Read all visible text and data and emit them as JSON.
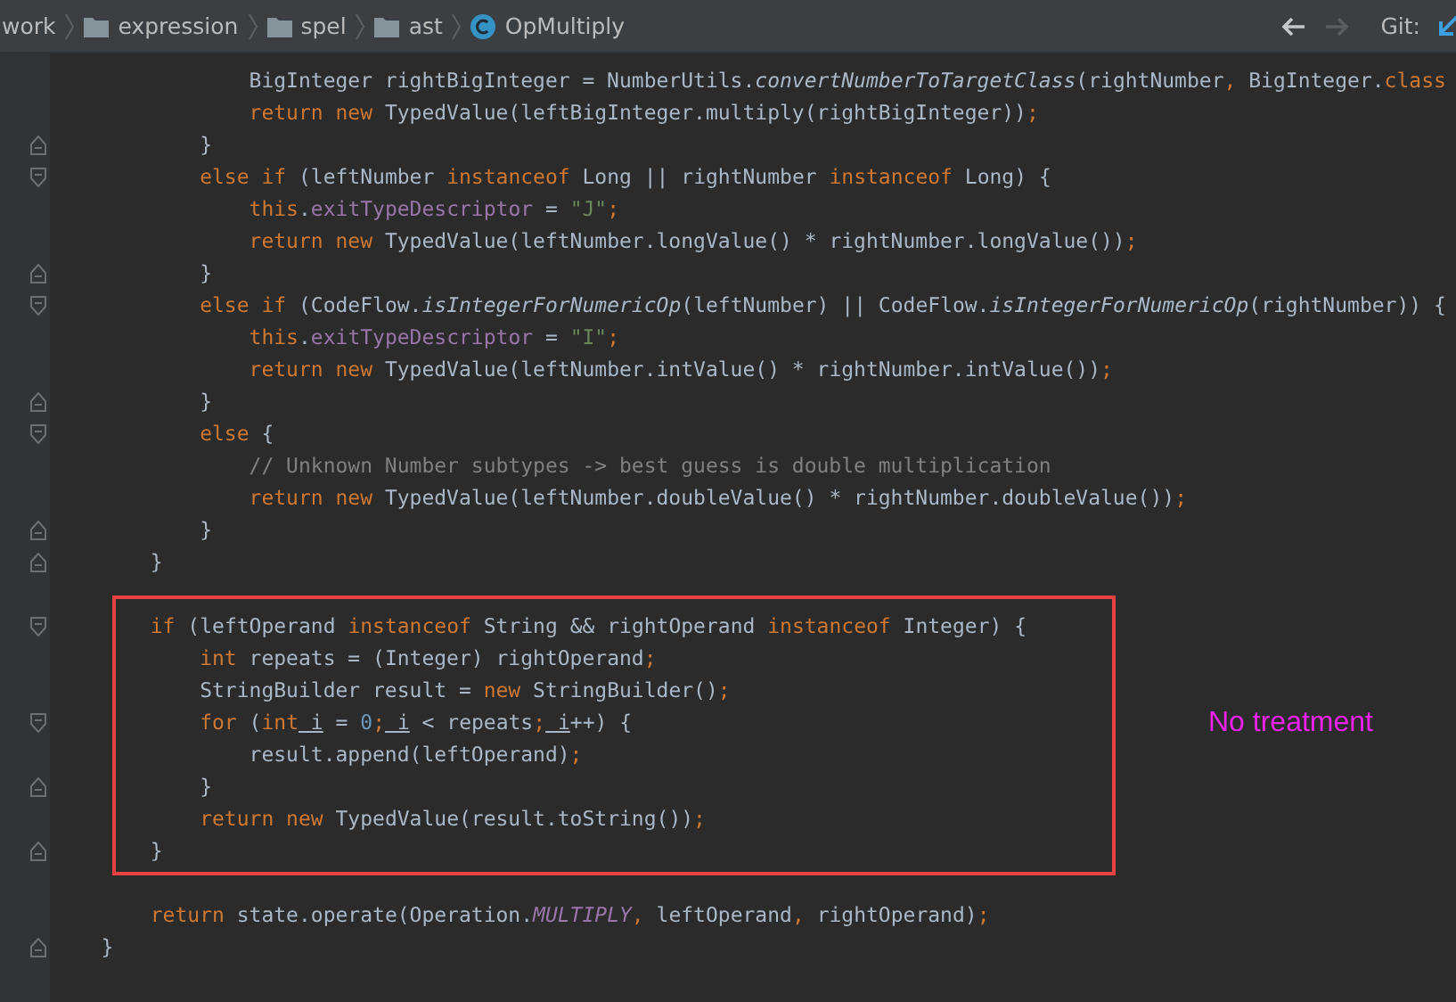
{
  "breadcrumb": {
    "items": [
      {
        "label": "work",
        "kind": "package"
      },
      {
        "label": "expression",
        "kind": "folder"
      },
      {
        "label": "spel",
        "kind": "folder"
      },
      {
        "label": "ast",
        "kind": "folder"
      },
      {
        "label": "OpMultiply",
        "kind": "class"
      }
    ],
    "back": {
      "disabled": false
    },
    "forward": {
      "disabled": true
    },
    "vcs_label": "Git:"
  },
  "code": {
    "lines": [
      {
        "fold_start": false,
        "fold_end": false,
        "tokens": [
          {
            "kind": "plain",
            "text": "                BigInteger rightBigInteger = NumberUtils."
          },
          {
            "kind": "method",
            "text": "convertNumberToTargetClass"
          },
          {
            "kind": "plain",
            "text": "(rightNumber"
          },
          {
            "kind": "keyword",
            "text": ","
          },
          {
            "kind": "plain",
            "text": " BigInteger."
          },
          {
            "kind": "keyword",
            "text": "class"
          }
        ]
      },
      {
        "fold_start": false,
        "fold_end": false,
        "tokens": [
          {
            "kind": "keyword",
            "text": "                return new"
          },
          {
            "kind": "plain",
            "text": " TypedValue(leftBigInteger.multiply(rightBigInteger))"
          },
          {
            "kind": "keyword",
            "text": ";"
          }
        ]
      },
      {
        "fold_start": false,
        "fold_end": true,
        "tokens": [
          {
            "kind": "plain",
            "text": "            }"
          }
        ]
      },
      {
        "fold_start": true,
        "fold_end": false,
        "tokens": [
          {
            "kind": "keyword",
            "text": "            else if"
          },
          {
            "kind": "plain",
            "text": " (leftNumber "
          },
          {
            "kind": "keyword",
            "text": "instanceof"
          },
          {
            "kind": "plain",
            "text": " Long || rightNumber "
          },
          {
            "kind": "keyword",
            "text": "instanceof"
          },
          {
            "kind": "plain",
            "text": " Long) {"
          }
        ]
      },
      {
        "fold_start": false,
        "fold_end": false,
        "tokens": [
          {
            "kind": "keyword",
            "text": "                this"
          },
          {
            "kind": "plain",
            "text": "."
          },
          {
            "kind": "field",
            "text": "exitTypeDescriptor"
          },
          {
            "kind": "plain",
            "text": " = "
          },
          {
            "kind": "string",
            "text": "\"J\""
          },
          {
            "kind": "keyword",
            "text": ";"
          }
        ]
      },
      {
        "fold_start": false,
        "fold_end": false,
        "tokens": [
          {
            "kind": "keyword",
            "text": "                return new"
          },
          {
            "kind": "plain",
            "text": " TypedValue(leftNumber.longValue() * rightNumber.longValue())"
          },
          {
            "kind": "keyword",
            "text": ";"
          }
        ]
      },
      {
        "fold_start": false,
        "fold_end": true,
        "tokens": [
          {
            "kind": "plain",
            "text": "            }"
          }
        ]
      },
      {
        "fold_start": true,
        "fold_end": false,
        "tokens": [
          {
            "kind": "keyword",
            "text": "            else if"
          },
          {
            "kind": "plain",
            "text": " (CodeFlow."
          },
          {
            "kind": "method",
            "text": "isIntegerForNumericOp"
          },
          {
            "kind": "plain",
            "text": "(leftNumber) || CodeFlow."
          },
          {
            "kind": "method",
            "text": "isIntegerForNumericOp"
          },
          {
            "kind": "plain",
            "text": "(rightNumber)) {"
          }
        ]
      },
      {
        "fold_start": false,
        "fold_end": false,
        "tokens": [
          {
            "kind": "keyword",
            "text": "                this"
          },
          {
            "kind": "plain",
            "text": "."
          },
          {
            "kind": "field",
            "text": "exitTypeDescriptor"
          },
          {
            "kind": "plain",
            "text": " = "
          },
          {
            "kind": "string",
            "text": "\"I\""
          },
          {
            "kind": "keyword",
            "text": ";"
          }
        ]
      },
      {
        "fold_start": false,
        "fold_end": false,
        "tokens": [
          {
            "kind": "keyword",
            "text": "                return new"
          },
          {
            "kind": "plain",
            "text": " TypedValue(leftNumber.intValue() * rightNumber.intValue())"
          },
          {
            "kind": "keyword",
            "text": ";"
          }
        ]
      },
      {
        "fold_start": false,
        "fold_end": true,
        "tokens": [
          {
            "kind": "plain",
            "text": "            }"
          }
        ]
      },
      {
        "fold_start": true,
        "fold_end": false,
        "tokens": [
          {
            "kind": "keyword",
            "text": "            else"
          },
          {
            "kind": "plain",
            "text": " {"
          }
        ]
      },
      {
        "fold_start": false,
        "fold_end": false,
        "tokens": [
          {
            "kind": "comment",
            "text": "                // Unknown Number subtypes -> best guess is double multiplication"
          }
        ]
      },
      {
        "fold_start": false,
        "fold_end": false,
        "tokens": [
          {
            "kind": "keyword",
            "text": "                return new"
          },
          {
            "kind": "plain",
            "text": " TypedValue(leftNumber.doubleValue() * rightNumber.doubleValue())"
          },
          {
            "kind": "keyword",
            "text": ";"
          }
        ]
      },
      {
        "fold_start": false,
        "fold_end": true,
        "tokens": [
          {
            "kind": "plain",
            "text": "            }"
          }
        ]
      },
      {
        "fold_start": false,
        "fold_end": true,
        "tokens": [
          {
            "kind": "plain",
            "text": "        }"
          }
        ]
      },
      {
        "fold_start": true,
        "fold_end": false,
        "gap_before": true,
        "tokens": [
          {
            "kind": "keyword",
            "text": "        if"
          },
          {
            "kind": "plain",
            "text": " (leftOperand "
          },
          {
            "kind": "keyword",
            "text": "instanceof"
          },
          {
            "kind": "plain",
            "text": " String && rightOperand "
          },
          {
            "kind": "keyword",
            "text": "instanceof"
          },
          {
            "kind": "plain",
            "text": " Integer) {"
          }
        ]
      },
      {
        "fold_start": false,
        "fold_end": false,
        "tokens": [
          {
            "kind": "keyword",
            "text": "            int"
          },
          {
            "kind": "plain",
            "text": " repeats = (Integer) rightOperand"
          },
          {
            "kind": "keyword",
            "text": ";"
          }
        ]
      },
      {
        "fold_start": false,
        "fold_end": false,
        "tokens": [
          {
            "kind": "plain",
            "text": "            StringBuilder result = "
          },
          {
            "kind": "keyword",
            "text": "new"
          },
          {
            "kind": "plain",
            "text": " StringBuilder()"
          },
          {
            "kind": "keyword",
            "text": ";"
          }
        ]
      },
      {
        "fold_start": true,
        "fold_end": false,
        "tokens": [
          {
            "kind": "keyword",
            "text": "            for"
          },
          {
            "kind": "plain",
            "text": " ("
          },
          {
            "kind": "keyword",
            "text": "int"
          },
          {
            "kind": "reassigned",
            "text": " i"
          },
          {
            "kind": "plain",
            "text": " = "
          },
          {
            "kind": "number",
            "text": "0"
          },
          {
            "kind": "keyword",
            "text": ";"
          },
          {
            "kind": "reassigned",
            "text": " i"
          },
          {
            "kind": "plain",
            "text": " < repeats"
          },
          {
            "kind": "keyword",
            "text": ";"
          },
          {
            "kind": "reassigned",
            "text": " i"
          },
          {
            "kind": "plain",
            "text": "++) {"
          }
        ]
      },
      {
        "fold_start": false,
        "fold_end": false,
        "tokens": [
          {
            "kind": "plain",
            "text": "                result.append(leftOperand)"
          },
          {
            "kind": "keyword",
            "text": ";"
          }
        ]
      },
      {
        "fold_start": false,
        "fold_end": true,
        "tokens": [
          {
            "kind": "plain",
            "text": "            }"
          }
        ]
      },
      {
        "fold_start": false,
        "fold_end": false,
        "tokens": [
          {
            "kind": "keyword",
            "text": "            return new"
          },
          {
            "kind": "plain",
            "text": " TypedValue(result.toString())"
          },
          {
            "kind": "keyword",
            "text": ";"
          }
        ]
      },
      {
        "fold_start": false,
        "fold_end": true,
        "tokens": [
          {
            "kind": "plain",
            "text": "        }"
          }
        ]
      },
      {
        "fold_start": false,
        "fold_end": false,
        "gap_before": true,
        "tokens": [
          {
            "kind": "keyword",
            "text": "        return"
          },
          {
            "kind": "plain",
            "text": " state.operate(Operation."
          },
          {
            "kind": "constant",
            "text": "MULTIPLY"
          },
          {
            "kind": "keyword",
            "text": ","
          },
          {
            "kind": "plain",
            "text": " leftOperand"
          },
          {
            "kind": "keyword",
            "text": ","
          },
          {
            "kind": "plain",
            "text": " rightOperand)"
          },
          {
            "kind": "keyword",
            "text": ";"
          }
        ]
      },
      {
        "fold_start": false,
        "fold_end": true,
        "tokens": [
          {
            "kind": "plain",
            "text": "    }"
          }
        ]
      }
    ]
  },
  "annotation": {
    "note": "No treatment"
  }
}
